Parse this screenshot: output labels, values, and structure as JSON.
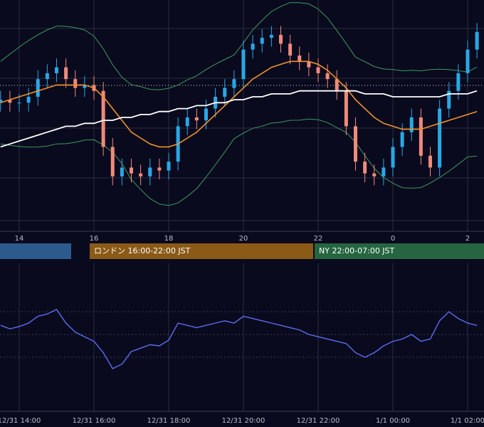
{
  "colors": {
    "background": "#0a0a1e",
    "grid": "#2a2c40",
    "candle_up": "#29a8e6",
    "candle_down": "#f08a7a",
    "ma_short": "#f0922a",
    "ma_long": "#ffffff",
    "bollinger": "#3e9a5e",
    "rsi": "#5b6cf0",
    "session_tokyo": "#2d5a8c",
    "session_london": "#8a5a16",
    "session_ny": "#256640"
  },
  "sessions": [
    {
      "key": "tokyo",
      "label": ""
    },
    {
      "key": "london",
      "label": "ロンドン 16:00-22:00 JST"
    },
    {
      "key": "ny",
      "label": "NY 22:00-07:00 JST"
    }
  ],
  "chart_data": [
    {
      "type": "candlestick",
      "title": "",
      "x_ticks": [
        "14",
        "16",
        "18",
        "20",
        "22",
        "0",
        "2"
      ],
      "grid": true,
      "horizontal_reference": "dotted",
      "indicators": [
        "moving average (orange)",
        "moving average (white)",
        "bollinger bands (green)"
      ],
      "x_hours": [
        13.5,
        13.75,
        14.0,
        14.25,
        14.5,
        14.75,
        15.0,
        15.25,
        15.5,
        15.75,
        16.0,
        16.25,
        16.5,
        16.75,
        17.0,
        17.25,
        17.5,
        17.75,
        18.0,
        18.25,
        18.5,
        18.75,
        19.0,
        19.25,
        19.5,
        19.75,
        20.0,
        20.25,
        20.5,
        20.75,
        21.0,
        21.25,
        21.5,
        21.75,
        22.0,
        22.25,
        22.5,
        22.75,
        23.0,
        23.25,
        23.5,
        23.75,
        24.0,
        24.25,
        24.5,
        24.75,
        25.0,
        25.25,
        25.5,
        25.75,
        26.0,
        26.25
      ],
      "close": [
        61,
        60,
        60,
        62,
        68,
        70,
        72,
        68,
        65,
        66,
        64,
        45,
        35,
        38,
        36,
        35,
        38,
        37,
        40,
        52,
        55,
        54,
        58,
        62,
        65,
        68,
        78,
        80,
        82,
        83,
        80,
        76,
        74,
        72,
        70,
        68,
        64,
        52,
        40,
        36,
        35,
        38,
        45,
        50,
        55,
        42,
        38,
        58,
        64,
        70,
        78,
        84
      ],
      "ma_short": [
        60,
        61,
        62,
        63,
        64,
        65,
        66,
        66,
        66,
        66,
        65,
        62,
        58,
        54,
        50,
        48,
        46,
        45,
        45,
        46,
        48,
        50,
        53,
        56,
        59,
        62,
        65,
        68,
        70,
        72,
        73,
        74,
        74,
        74,
        73,
        71,
        68,
        65,
        61,
        58,
        55,
        53,
        52,
        51,
        51,
        51,
        52,
        53,
        54,
        55,
        56,
        57
      ],
      "ma_long": [
        45,
        46,
        47,
        48,
        49,
        50,
        51,
        52,
        52,
        53,
        53,
        54,
        54,
        55,
        55,
        56,
        56,
        57,
        57,
        58,
        58,
        59,
        59,
        60,
        60,
        61,
        61,
        62,
        62,
        63,
        63,
        63,
        64,
        64,
        64,
        64,
        64,
        64,
        64,
        63,
        63,
        63,
        62,
        62,
        62,
        62,
        62,
        62,
        63,
        63,
        63,
        64
      ]
    },
    {
      "type": "line",
      "title": "",
      "x_ticks": [
        "12/31 14:00",
        "12/31 16:00",
        "12/31 18:00",
        "12/31 20:00",
        "12/31 22:00",
        "1/1 00:00",
        "1/1 02:00"
      ],
      "ylim": [
        0,
        100
      ],
      "grid": true,
      "series": [
        {
          "values": [
            58,
            55,
            57,
            60,
            66,
            68,
            72,
            60,
            52,
            48,
            44,
            34,
            20,
            24,
            35,
            38,
            41,
            40,
            45,
            60,
            58,
            56,
            58,
            60,
            62,
            60,
            66,
            64,
            62,
            60,
            58,
            56,
            54,
            50,
            48,
            46,
            44,
            42,
            34,
            30,
            34,
            40,
            44,
            46,
            50,
            44,
            46,
            62,
            70,
            64,
            60,
            58
          ]
        }
      ]
    }
  ]
}
